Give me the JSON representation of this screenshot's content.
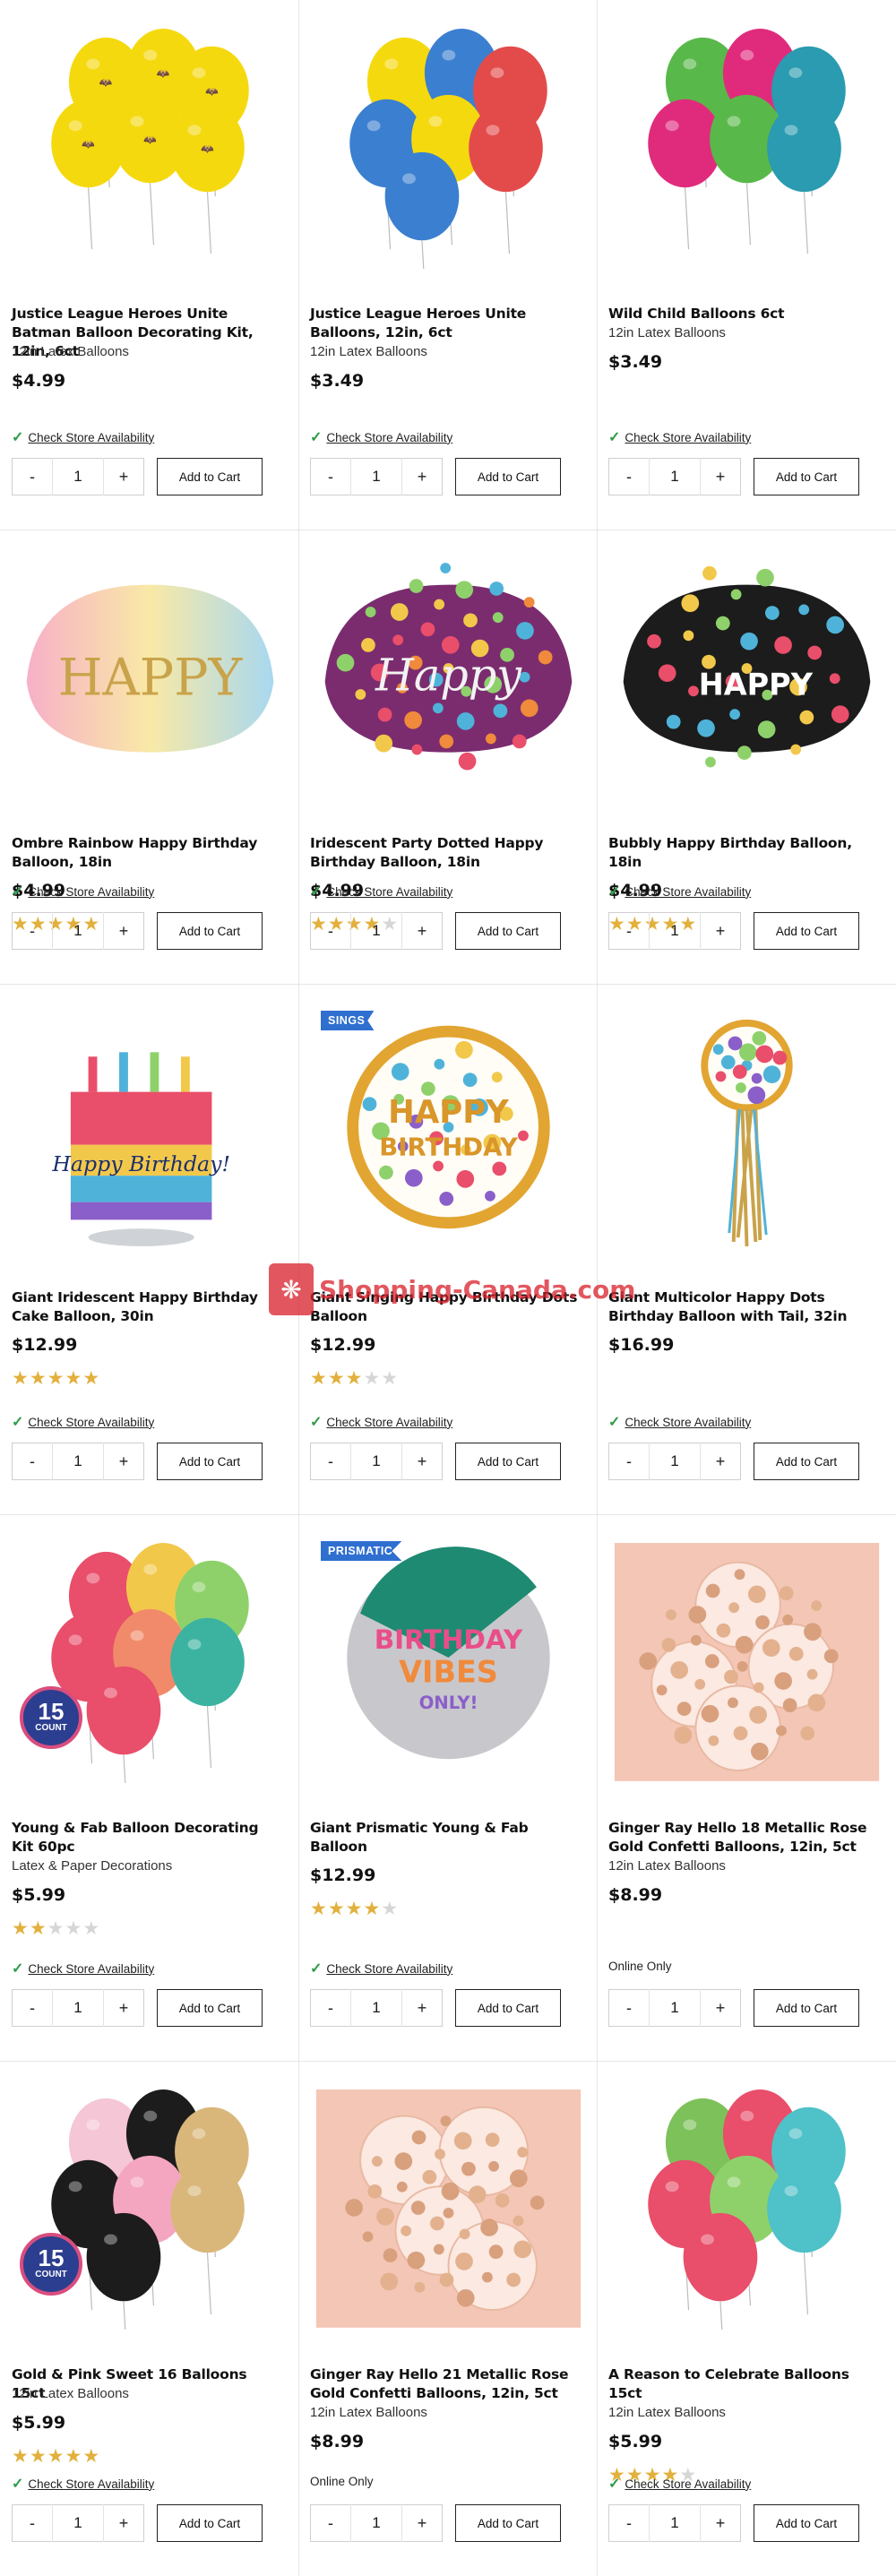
{
  "ui": {
    "add_to_cart": "Add to Cart",
    "check_store": "Check Store Availability",
    "online_only": "Online Only",
    "qty_minus": "-",
    "qty_plus": "+",
    "qty_default": "1"
  },
  "watermark": {
    "text": "Shopping-Canada.com"
  },
  "colors": {
    "star": "#e2b03c",
    "check": "#2e9b48",
    "badge": "#2f6fd0"
  },
  "products": [
    {
      "title": "Justice League Heroes Unite Batman Balloon Decorating Kit, 12in, 6ct",
      "subtitle": "12in Latex Balloons",
      "price": "$4.99",
      "rating": null,
      "availability": "check",
      "image": "batman-yellow-balloons"
    },
    {
      "title": "Justice League Heroes Unite Balloons, 12in, 6ct",
      "subtitle": "12in Latex Balloons",
      "price": "$3.49",
      "rating": null,
      "availability": "check",
      "image": "justice-league-balloons"
    },
    {
      "title": "Wild Child Balloons 6ct",
      "subtitle": "12in Latex Balloons",
      "price": "$3.49",
      "rating": null,
      "availability": "check",
      "image": "wild-child-balloons"
    },
    {
      "title": "Ombre Rainbow Happy Birthday Balloon, 18in",
      "subtitle": "",
      "price": "$4.99",
      "rating": 5,
      "availability": "check",
      "image": "ombre-rainbow-happy"
    },
    {
      "title": "Iridescent Party Dotted Happy Birthday Balloon, 18in",
      "subtitle": "",
      "price": "$4.99",
      "rating": 3.5,
      "availability": "check",
      "image": "iridescent-dotted-happy"
    },
    {
      "title": "Bubbly Happy Birthday Balloon, 18in",
      "subtitle": "",
      "price": "$4.99",
      "rating": 4.5,
      "availability": "check",
      "image": "bubbly-happy-birthday"
    },
    {
      "title": "Giant Iridescent Happy Birthday Cake Balloon, 30in",
      "subtitle": "",
      "price": "$12.99",
      "rating": 5,
      "availability": "check",
      "image": "cake-balloon"
    },
    {
      "title": "Giant Singing Happy Birthday Dots Balloon",
      "subtitle": "",
      "price": "$12.99",
      "rating": 3,
      "availability": "check",
      "image": "singing-dots-balloon",
      "badge": "SINGS"
    },
    {
      "title": "Giant Multicolor Happy Dots Birthday Balloon with Tail, 32in",
      "subtitle": "",
      "price": "$16.99",
      "rating": null,
      "availability": "check",
      "image": "dots-balloon-tail"
    },
    {
      "title": "Young & Fab Balloon Decorating Kit 60pc",
      "subtitle": "Latex & Paper Decorations",
      "price": "$5.99",
      "rating": 2,
      "availability": "check",
      "image": "young-fab-kit",
      "count_badge": {
        "number": "15",
        "label": "COUNT"
      }
    },
    {
      "title": "Giant Prismatic Young & Fab Balloon",
      "subtitle": "",
      "price": "$12.99",
      "rating": 4,
      "availability": "check",
      "image": "prismatic-birthday-vibes",
      "badge": "PRISMATIC"
    },
    {
      "title": "Ginger Ray Hello 18 Metallic Rose Gold Confetti Balloons, 12in, 5ct",
      "subtitle": "12in Latex Balloons",
      "price": "$8.99",
      "rating": null,
      "availability": "online",
      "image": "hello-18-balloons"
    },
    {
      "title": "Gold & Pink Sweet 16 Balloons 15ct",
      "subtitle": "12in Latex Balloons",
      "price": "$5.99",
      "rating": 4.5,
      "availability": "check",
      "image": "sweet-16-balloons",
      "count_badge": {
        "number": "15",
        "label": "COUNT"
      }
    },
    {
      "title": "Ginger Ray Hello 21 Metallic Rose Gold Confetti Balloons, 12in, 5ct",
      "subtitle": "12in Latex Balloons",
      "price": "$8.99",
      "rating": null,
      "availability": "online",
      "image": "hello-21-balloons"
    },
    {
      "title": "A Reason to Celebrate Balloons 15ct",
      "subtitle": "12in Latex Balloons",
      "price": "$5.99",
      "rating": 4,
      "availability": "check",
      "image": "reason-to-celebrate-balloons"
    }
  ]
}
